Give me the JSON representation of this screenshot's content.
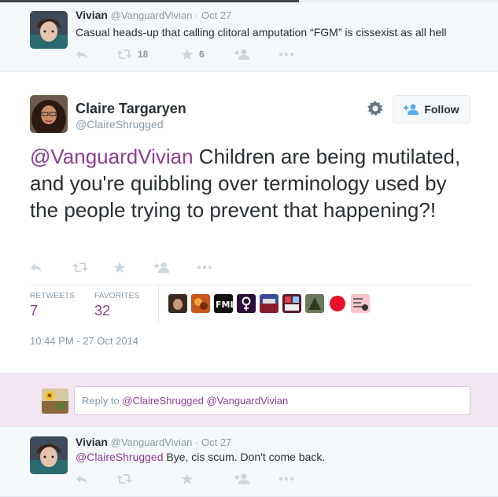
{
  "tweet1": {
    "name": "Vivian",
    "handle": "@VanguardVivian",
    "dot_time": "· Oct 27",
    "text": "Casual heads-up that calling clitoral amputation “FGM” is cissexist as all hell",
    "retweets": "18",
    "favorites": "6"
  },
  "main_tweet": {
    "name": "Claire Targaryen",
    "handle": "@ClaireShrugged",
    "follow_label": "Follow",
    "mention": "@VanguardVivian",
    "text": " Children are being mutilated, and you're quibbling over terminology used by the people trying to prevent that happening?!",
    "retweets_label": "RETWEETS",
    "retweets_count": "7",
    "favorites_label": "FAVORITES",
    "favorites_count": "32",
    "timestamp": "10:44 PM - 27 Oct 2014",
    "favoriter_count_avatars": 9
  },
  "reply_box": {
    "prefix": "Reply to ",
    "mention1": "@ClaireShrugged",
    "mention2": "@VanguardVivian"
  },
  "reply_tweet": {
    "name": "Vivian",
    "handle": "@VanguardVivian",
    "dot_time": "· Oct 27",
    "mention": "@ClaireShrugged",
    "text": " Bye, cis scum. Don't come back."
  },
  "icons": {
    "reply": "reply-icon",
    "retweet": "retweet-icon",
    "favorite": "star-icon",
    "follow": "follow-person-icon",
    "more": "more-icon",
    "settings": "gear-icon"
  },
  "colors": {
    "mention": "#8e3c94",
    "muted": "#8899a6",
    "reply_bg": "#f2e6f3"
  }
}
